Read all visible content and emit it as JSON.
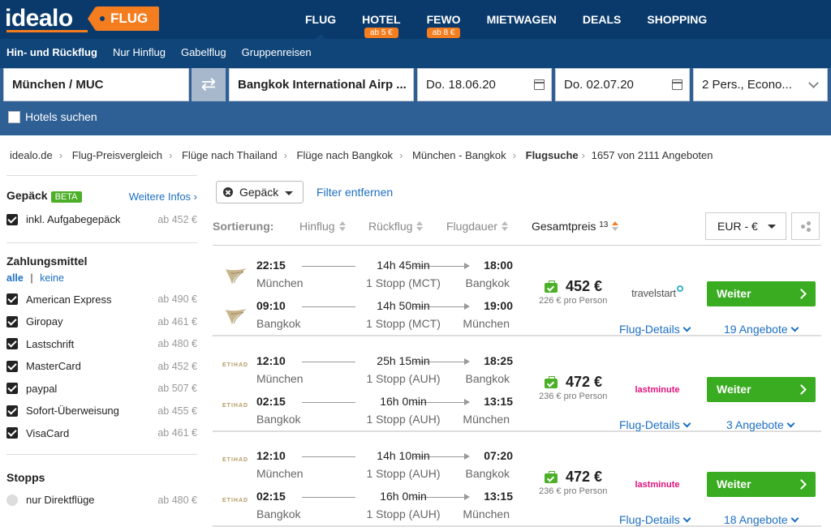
{
  "header": {
    "logo_text": "idealo",
    "product_tag": "FLUG",
    "nav": [
      {
        "label": "FLUG",
        "badge": "",
        "active": true
      },
      {
        "label": "HOTEL",
        "badge": "ab 5 €",
        "active": false
      },
      {
        "label": "FEWO",
        "badge": "ab 8 €",
        "active": false
      },
      {
        "label": "MIETWAGEN",
        "badge": "",
        "active": false
      },
      {
        "label": "DEALS",
        "badge": "",
        "active": false
      },
      {
        "label": "SHOPPING",
        "badge": "",
        "active": false
      }
    ],
    "trip_types": [
      "Hin- und Rückflug",
      "Nur Hinflug",
      "Gabelflug",
      "Gruppenreisen"
    ]
  },
  "search": {
    "origin": "München / MUC",
    "destination": "Bangkok International Airp ...",
    "depart_date": "Do. 18.06.20",
    "return_date": "Do. 02.07.20",
    "passengers": "2 Pers., Econo...",
    "hotels_label": "Hotels suchen",
    "swap_icon": "⇄"
  },
  "breadcrumb": [
    "idealo.de",
    "Flug-Preisvergleich",
    "Flüge nach Thailand",
    "Flüge nach Bangkok",
    "München - Bangkok",
    "Flugsuche",
    "1657 von 2111 Angeboten"
  ],
  "sidebar": {
    "baggage_title": "Gepäck",
    "baggage_badge": "BETA",
    "more_info": "Weitere Infos ›",
    "baggage_option": {
      "label": "inkl. Aufgabegepäck",
      "price": "ab 452 €"
    },
    "payment_title": "Zahlungsmittel",
    "all_label": "alle",
    "none_label": "keine",
    "payments": [
      {
        "label": "American Express",
        "price": "ab 490 €"
      },
      {
        "label": "Giropay",
        "price": "ab 461 €"
      },
      {
        "label": "Lastschrift",
        "price": "ab 480 €"
      },
      {
        "label": "MasterCard",
        "price": "ab 452 €"
      },
      {
        "label": "paypal",
        "price": "ab 507 €"
      },
      {
        "label": "Sofort-Überweisung",
        "price": "ab 455 €"
      },
      {
        "label": "VisaCard",
        "price": "ab 461 €"
      }
    ],
    "stops_title": "Stopps",
    "stops_option": {
      "label": "nur Direktflüge",
      "price": "ab 480 €"
    }
  },
  "filters": {
    "active_filter": "Gepäck",
    "clear_label": "Filter entfernen"
  },
  "sort": {
    "label": "Sortierung:",
    "options": [
      "Hinflug",
      "Rückflug",
      "Flugdauer",
      "Gesamtpreis"
    ],
    "active_sup": "13",
    "currency": "EUR - €"
  },
  "results": [
    {
      "legs": [
        {
          "dep_time": "22:15",
          "dep_city": "München",
          "duration": "14h 45min",
          "stops": "1 Stopp (MCT)",
          "arr_time": "18:00",
          "arr_city": "Bangkok"
        },
        {
          "dep_time": "09:10",
          "dep_city": "Bangkok",
          "duration": "14h 50min",
          "stops": "1 Stopp (MCT)",
          "arr_time": "19:00",
          "arr_city": "München"
        }
      ],
      "airline_icon": "oman-air-logo-icon",
      "price": "452 €",
      "price_per_person": "226 € pro Person",
      "provider": "travelstart",
      "cta": "Weiter",
      "details_label": "Flug-Details",
      "offers_label": "19 Angebote"
    },
    {
      "legs": [
        {
          "dep_time": "12:10",
          "dep_city": "München",
          "duration": "25h 15min",
          "stops": "1 Stopp (AUH)",
          "arr_time": "18:25",
          "arr_city": "Bangkok"
        },
        {
          "dep_time": "02:15",
          "dep_city": "Bangkok",
          "duration": "16h 0min",
          "stops": "1 Stopp (AUH)",
          "arr_time": "13:15",
          "arr_city": "München"
        }
      ],
      "airline_icon": "etihad-logo-icon",
      "airline_text": "ETIHAD",
      "price": "472 €",
      "price_per_person": "236 € pro Person",
      "provider": "lastminute",
      "cta": "Weiter",
      "details_label": "Flug-Details",
      "offers_label": "3 Angebote"
    },
    {
      "legs": [
        {
          "dep_time": "12:10",
          "dep_city": "München",
          "duration": "14h 10min",
          "stops": "1 Stopp (AUH)",
          "arr_time": "07:20",
          "arr_city": "Bangkok"
        },
        {
          "dep_time": "02:15",
          "dep_city": "Bangkok",
          "duration": "16h 0min",
          "stops": "1 Stopp (AUH)",
          "arr_time": "13:15",
          "arr_city": "München"
        }
      ],
      "airline_icon": "etihad-logo-icon",
      "airline_text": "ETIHAD",
      "price": "472 €",
      "price_per_person": "236 € pro Person",
      "provider": "lastminute",
      "cta": "Weiter",
      "details_label": "Flug-Details",
      "offers_label": "18 Angebote"
    }
  ],
  "colors": {
    "header_bg": "#0a3a6b",
    "subnav_bg": "#0f4579",
    "search_bg": "#2e5f95",
    "accent_orange": "#f47d20",
    "cta_green": "#3aac21",
    "link_blue": "#1b6ec2"
  }
}
